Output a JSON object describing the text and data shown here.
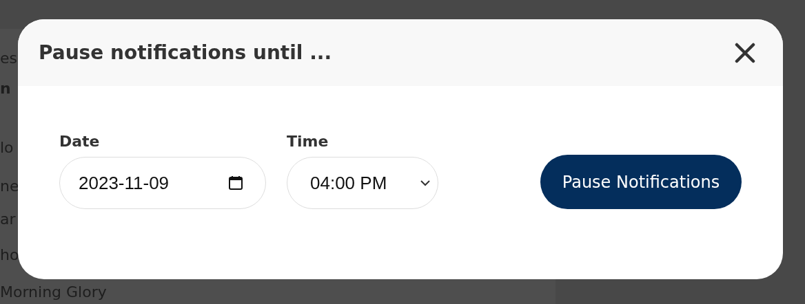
{
  "background": {
    "items": [
      {
        "text": "es",
        "bold": false
      },
      {
        "text": "n",
        "bold": true
      },
      {
        "text": "lo",
        "bold": false
      },
      {
        "text": "ne",
        "bold": false
      },
      {
        "text": "ar",
        "bold": false
      },
      {
        "text": "ho",
        "bold": false
      },
      {
        "text": "Morning Glory",
        "bold": false
      }
    ]
  },
  "dialog": {
    "title": "Pause notifications until ...",
    "date": {
      "label": "Date",
      "value": "2023-11-09"
    },
    "time": {
      "label": "Time",
      "value": "04:00 PM"
    },
    "button": "Pause Notifications"
  }
}
